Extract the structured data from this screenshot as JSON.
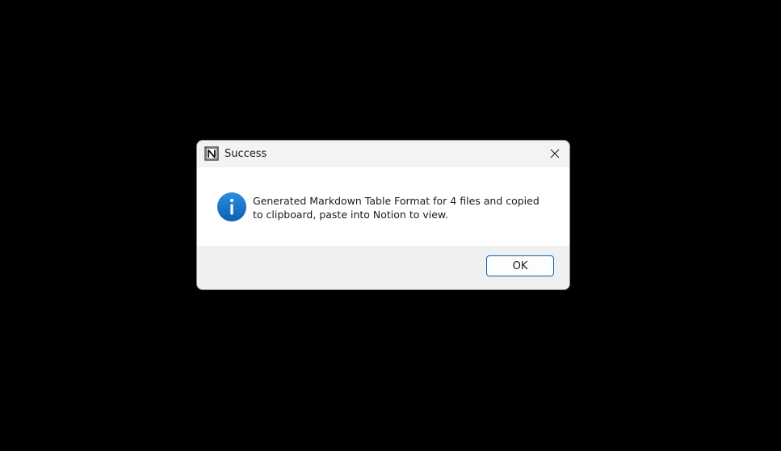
{
  "dialog": {
    "title": "Success",
    "app_icon": "notion-logo-icon",
    "close_icon": "close-icon",
    "info_icon": "info-icon",
    "message": "Generated Markdown Table Format for 4 files and copied to clipboard, paste into Notion to view.",
    "ok_label": "OK"
  },
  "colors": {
    "background": "#000000",
    "titlebar": "#f3f3f3",
    "footer": "#f0f0f0",
    "accent": "#0067c0",
    "info_icon": "#1a7fd4"
  }
}
